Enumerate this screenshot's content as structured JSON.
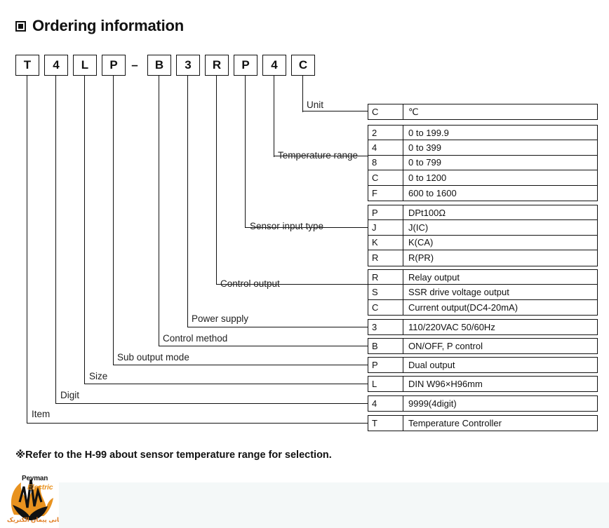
{
  "heading": {
    "bullet_icon": "filled-square-bullet-icon",
    "title": "Ordering information"
  },
  "model_code": {
    "boxes": [
      {
        "value": "T"
      },
      {
        "value": "4"
      },
      {
        "value": "L"
      },
      {
        "value": "P"
      },
      {
        "value": "B"
      },
      {
        "value": "3"
      },
      {
        "value": "R"
      },
      {
        "value": "P"
      },
      {
        "value": "4"
      },
      {
        "value": "C"
      }
    ],
    "separator": "–"
  },
  "leader_labels": [
    {
      "key": "unit",
      "label": "Unit"
    },
    {
      "key": "temperature_range",
      "label": "Temperature range"
    },
    {
      "key": "sensor_input_type",
      "label": "Sensor input type"
    },
    {
      "key": "control_output",
      "label": "Control output"
    },
    {
      "key": "power_supply",
      "label": "Power supply"
    },
    {
      "key": "control_method",
      "label": "Control method"
    },
    {
      "key": "sub_output_mode",
      "label": "Sub output mode"
    },
    {
      "key": "size",
      "label": "Size"
    },
    {
      "key": "digit",
      "label": "Digit"
    },
    {
      "key": "item",
      "label": "Item"
    }
  ],
  "spec_groups": [
    {
      "key": "unit",
      "rows": [
        {
          "code": "C",
          "desc": "℃"
        }
      ]
    },
    {
      "key": "temperature_range",
      "rows": [
        {
          "code": "2",
          "desc": "0 to 199.9"
        },
        {
          "code": "4",
          "desc": "0 to 399"
        },
        {
          "code": "8",
          "desc": "0 to 799"
        },
        {
          "code": "C",
          "desc": "0 to 1200"
        },
        {
          "code": "F",
          "desc": "600 to 1600"
        }
      ]
    },
    {
      "key": "sensor_input_type",
      "rows": [
        {
          "code": "P",
          "desc": "DPt100Ω"
        },
        {
          "code": "J",
          "desc": "J(IC)"
        },
        {
          "code": "K",
          "desc": "K(CA)"
        },
        {
          "code": "R",
          "desc": "R(PR)"
        }
      ]
    },
    {
      "key": "control_output",
      "rows": [
        {
          "code": "R",
          "desc": "Relay output"
        },
        {
          "code": "S",
          "desc": "SSR drive voltage output"
        },
        {
          "code": "C",
          "desc": "Current output(DC4-20mA)"
        }
      ]
    },
    {
      "key": "power_supply",
      "rows": [
        {
          "code": "3",
          "desc": "110/220VAC 50/60Hz"
        }
      ]
    },
    {
      "key": "control_method",
      "rows": [
        {
          "code": "B",
          "desc": "ON/OFF, P control"
        }
      ]
    },
    {
      "key": "sub_output_mode",
      "rows": [
        {
          "code": "P",
          "desc": "Dual output"
        }
      ]
    },
    {
      "key": "size",
      "rows": [
        {
          "code": "L",
          "desc": "DIN W96×H96mm"
        }
      ]
    },
    {
      "key": "digit",
      "rows": [
        {
          "code": "4",
          "desc": "9999(4digit)"
        }
      ]
    },
    {
      "key": "item",
      "rows": [
        {
          "code": "T",
          "desc": "Temperature Controller"
        }
      ]
    }
  ],
  "footnote": {
    "text": "※Refer to the H-99 about sensor temperature range for selection."
  },
  "logo": {
    "brand_line1": "Peyman",
    "brand_line2": "Electric",
    "persian_text": "بازرگانی پیمان الکتریک",
    "accent_color": "#e8921f",
    "dark_color": "#1a1a1a"
  }
}
